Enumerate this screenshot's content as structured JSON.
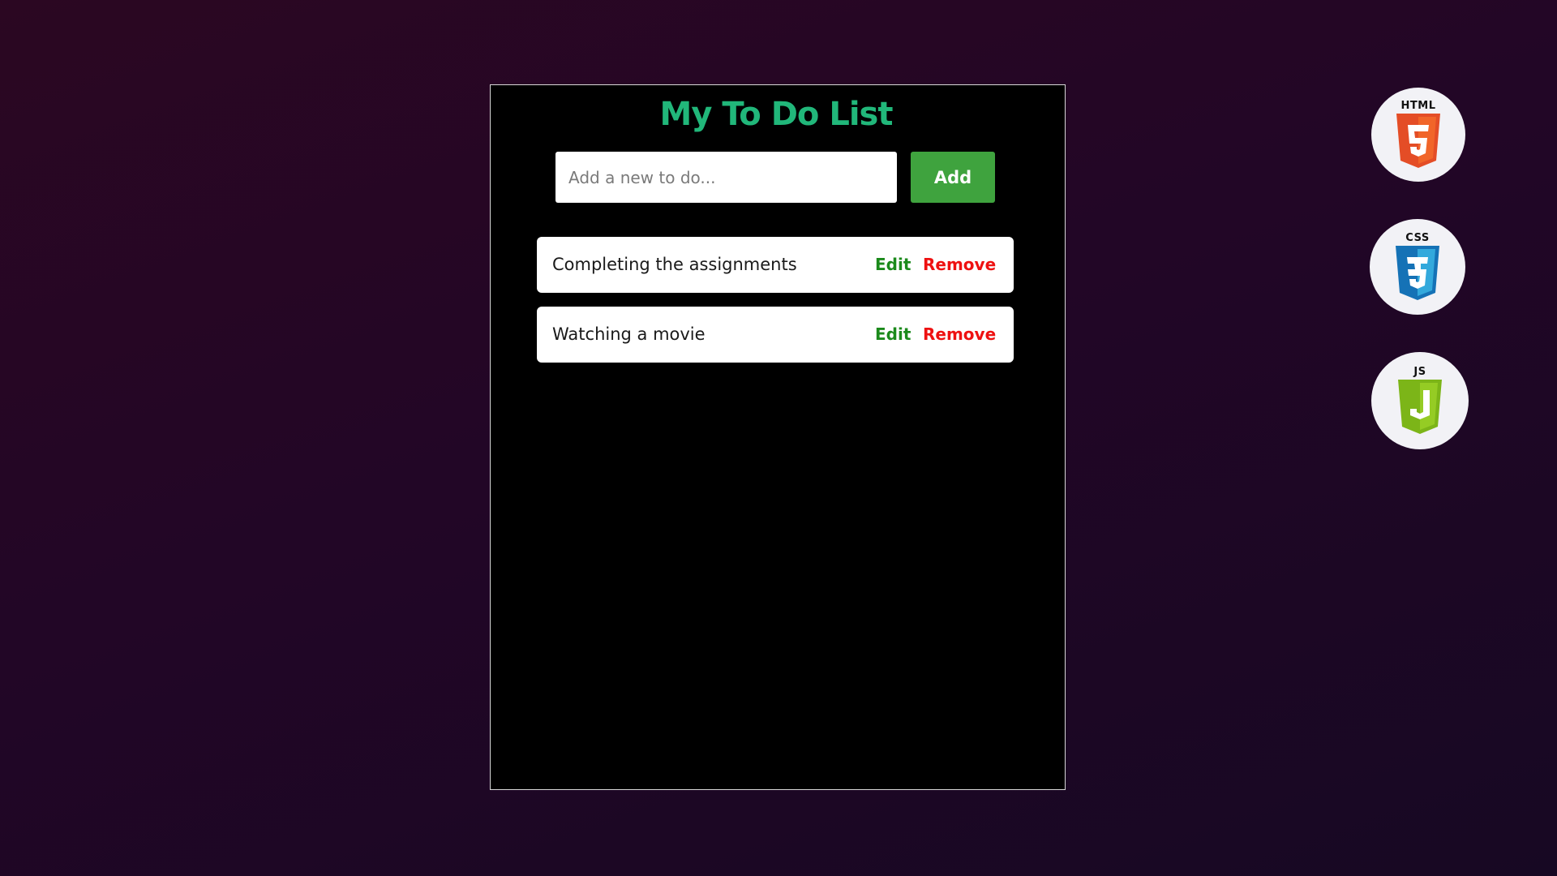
{
  "app": {
    "title": "My To Do List"
  },
  "form": {
    "input_placeholder": "Add a new to do...",
    "input_value": "",
    "add_label": "Add"
  },
  "todos": [
    {
      "text": "Completing the assignments",
      "edit_label": "Edit",
      "remove_label": "Remove"
    },
    {
      "text": "Watching a movie",
      "edit_label": "Edit",
      "remove_label": "Remove"
    }
  ],
  "badges": [
    {
      "label": "HTML",
      "icon": "html5-shield-icon",
      "color": "#e44d26"
    },
    {
      "label": "CSS",
      "icon": "css3-shield-icon",
      "color": "#1572b6"
    },
    {
      "label": "JS",
      "icon": "js-shield-icon",
      "color": "#7cb518"
    }
  ],
  "colors": {
    "title": "#21b77a",
    "add_button": "#3fa33e",
    "edit": "#1b8a1b",
    "remove": "#ee1111"
  }
}
